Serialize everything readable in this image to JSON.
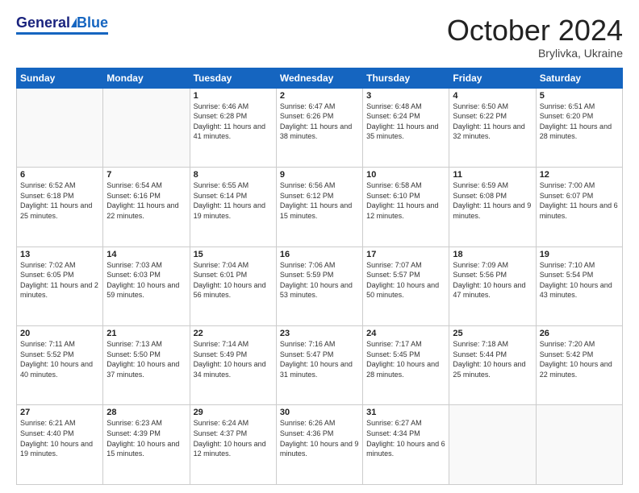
{
  "header": {
    "logo_general": "General",
    "logo_blue": "Blue",
    "month_title": "October 2024",
    "subtitle": "Brylivka, Ukraine"
  },
  "days_of_week": [
    "Sunday",
    "Monday",
    "Tuesday",
    "Wednesday",
    "Thursday",
    "Friday",
    "Saturday"
  ],
  "weeks": [
    [
      {
        "day": "",
        "sunrise": "",
        "sunset": "",
        "daylight": ""
      },
      {
        "day": "",
        "sunrise": "",
        "sunset": "",
        "daylight": ""
      },
      {
        "day": "1",
        "sunrise": "Sunrise: 6:46 AM",
        "sunset": "Sunset: 6:28 PM",
        "daylight": "Daylight: 11 hours and 41 minutes."
      },
      {
        "day": "2",
        "sunrise": "Sunrise: 6:47 AM",
        "sunset": "Sunset: 6:26 PM",
        "daylight": "Daylight: 11 hours and 38 minutes."
      },
      {
        "day": "3",
        "sunrise": "Sunrise: 6:48 AM",
        "sunset": "Sunset: 6:24 PM",
        "daylight": "Daylight: 11 hours and 35 minutes."
      },
      {
        "day": "4",
        "sunrise": "Sunrise: 6:50 AM",
        "sunset": "Sunset: 6:22 PM",
        "daylight": "Daylight: 11 hours and 32 minutes."
      },
      {
        "day": "5",
        "sunrise": "Sunrise: 6:51 AM",
        "sunset": "Sunset: 6:20 PM",
        "daylight": "Daylight: 11 hours and 28 minutes."
      }
    ],
    [
      {
        "day": "6",
        "sunrise": "Sunrise: 6:52 AM",
        "sunset": "Sunset: 6:18 PM",
        "daylight": "Daylight: 11 hours and 25 minutes."
      },
      {
        "day": "7",
        "sunrise": "Sunrise: 6:54 AM",
        "sunset": "Sunset: 6:16 PM",
        "daylight": "Daylight: 11 hours and 22 minutes."
      },
      {
        "day": "8",
        "sunrise": "Sunrise: 6:55 AM",
        "sunset": "Sunset: 6:14 PM",
        "daylight": "Daylight: 11 hours and 19 minutes."
      },
      {
        "day": "9",
        "sunrise": "Sunrise: 6:56 AM",
        "sunset": "Sunset: 6:12 PM",
        "daylight": "Daylight: 11 hours and 15 minutes."
      },
      {
        "day": "10",
        "sunrise": "Sunrise: 6:58 AM",
        "sunset": "Sunset: 6:10 PM",
        "daylight": "Daylight: 11 hours and 12 minutes."
      },
      {
        "day": "11",
        "sunrise": "Sunrise: 6:59 AM",
        "sunset": "Sunset: 6:08 PM",
        "daylight": "Daylight: 11 hours and 9 minutes."
      },
      {
        "day": "12",
        "sunrise": "Sunrise: 7:00 AM",
        "sunset": "Sunset: 6:07 PM",
        "daylight": "Daylight: 11 hours and 6 minutes."
      }
    ],
    [
      {
        "day": "13",
        "sunrise": "Sunrise: 7:02 AM",
        "sunset": "Sunset: 6:05 PM",
        "daylight": "Daylight: 11 hours and 2 minutes."
      },
      {
        "day": "14",
        "sunrise": "Sunrise: 7:03 AM",
        "sunset": "Sunset: 6:03 PM",
        "daylight": "Daylight: 10 hours and 59 minutes."
      },
      {
        "day": "15",
        "sunrise": "Sunrise: 7:04 AM",
        "sunset": "Sunset: 6:01 PM",
        "daylight": "Daylight: 10 hours and 56 minutes."
      },
      {
        "day": "16",
        "sunrise": "Sunrise: 7:06 AM",
        "sunset": "Sunset: 5:59 PM",
        "daylight": "Daylight: 10 hours and 53 minutes."
      },
      {
        "day": "17",
        "sunrise": "Sunrise: 7:07 AM",
        "sunset": "Sunset: 5:57 PM",
        "daylight": "Daylight: 10 hours and 50 minutes."
      },
      {
        "day": "18",
        "sunrise": "Sunrise: 7:09 AM",
        "sunset": "Sunset: 5:56 PM",
        "daylight": "Daylight: 10 hours and 47 minutes."
      },
      {
        "day": "19",
        "sunrise": "Sunrise: 7:10 AM",
        "sunset": "Sunset: 5:54 PM",
        "daylight": "Daylight: 10 hours and 43 minutes."
      }
    ],
    [
      {
        "day": "20",
        "sunrise": "Sunrise: 7:11 AM",
        "sunset": "Sunset: 5:52 PM",
        "daylight": "Daylight: 10 hours and 40 minutes."
      },
      {
        "day": "21",
        "sunrise": "Sunrise: 7:13 AM",
        "sunset": "Sunset: 5:50 PM",
        "daylight": "Daylight: 10 hours and 37 minutes."
      },
      {
        "day": "22",
        "sunrise": "Sunrise: 7:14 AM",
        "sunset": "Sunset: 5:49 PM",
        "daylight": "Daylight: 10 hours and 34 minutes."
      },
      {
        "day": "23",
        "sunrise": "Sunrise: 7:16 AM",
        "sunset": "Sunset: 5:47 PM",
        "daylight": "Daylight: 10 hours and 31 minutes."
      },
      {
        "day": "24",
        "sunrise": "Sunrise: 7:17 AM",
        "sunset": "Sunset: 5:45 PM",
        "daylight": "Daylight: 10 hours and 28 minutes."
      },
      {
        "day": "25",
        "sunrise": "Sunrise: 7:18 AM",
        "sunset": "Sunset: 5:44 PM",
        "daylight": "Daylight: 10 hours and 25 minutes."
      },
      {
        "day": "26",
        "sunrise": "Sunrise: 7:20 AM",
        "sunset": "Sunset: 5:42 PM",
        "daylight": "Daylight: 10 hours and 22 minutes."
      }
    ],
    [
      {
        "day": "27",
        "sunrise": "Sunrise: 6:21 AM",
        "sunset": "Sunset: 4:40 PM",
        "daylight": "Daylight: 10 hours and 19 minutes."
      },
      {
        "day": "28",
        "sunrise": "Sunrise: 6:23 AM",
        "sunset": "Sunset: 4:39 PM",
        "daylight": "Daylight: 10 hours and 15 minutes."
      },
      {
        "day": "29",
        "sunrise": "Sunrise: 6:24 AM",
        "sunset": "Sunset: 4:37 PM",
        "daylight": "Daylight: 10 hours and 12 minutes."
      },
      {
        "day": "30",
        "sunrise": "Sunrise: 6:26 AM",
        "sunset": "Sunset: 4:36 PM",
        "daylight": "Daylight: 10 hours and 9 minutes."
      },
      {
        "day": "31",
        "sunrise": "Sunrise: 6:27 AM",
        "sunset": "Sunset: 4:34 PM",
        "daylight": "Daylight: 10 hours and 6 minutes."
      },
      {
        "day": "",
        "sunrise": "",
        "sunset": "",
        "daylight": ""
      },
      {
        "day": "",
        "sunrise": "",
        "sunset": "",
        "daylight": ""
      }
    ]
  ]
}
